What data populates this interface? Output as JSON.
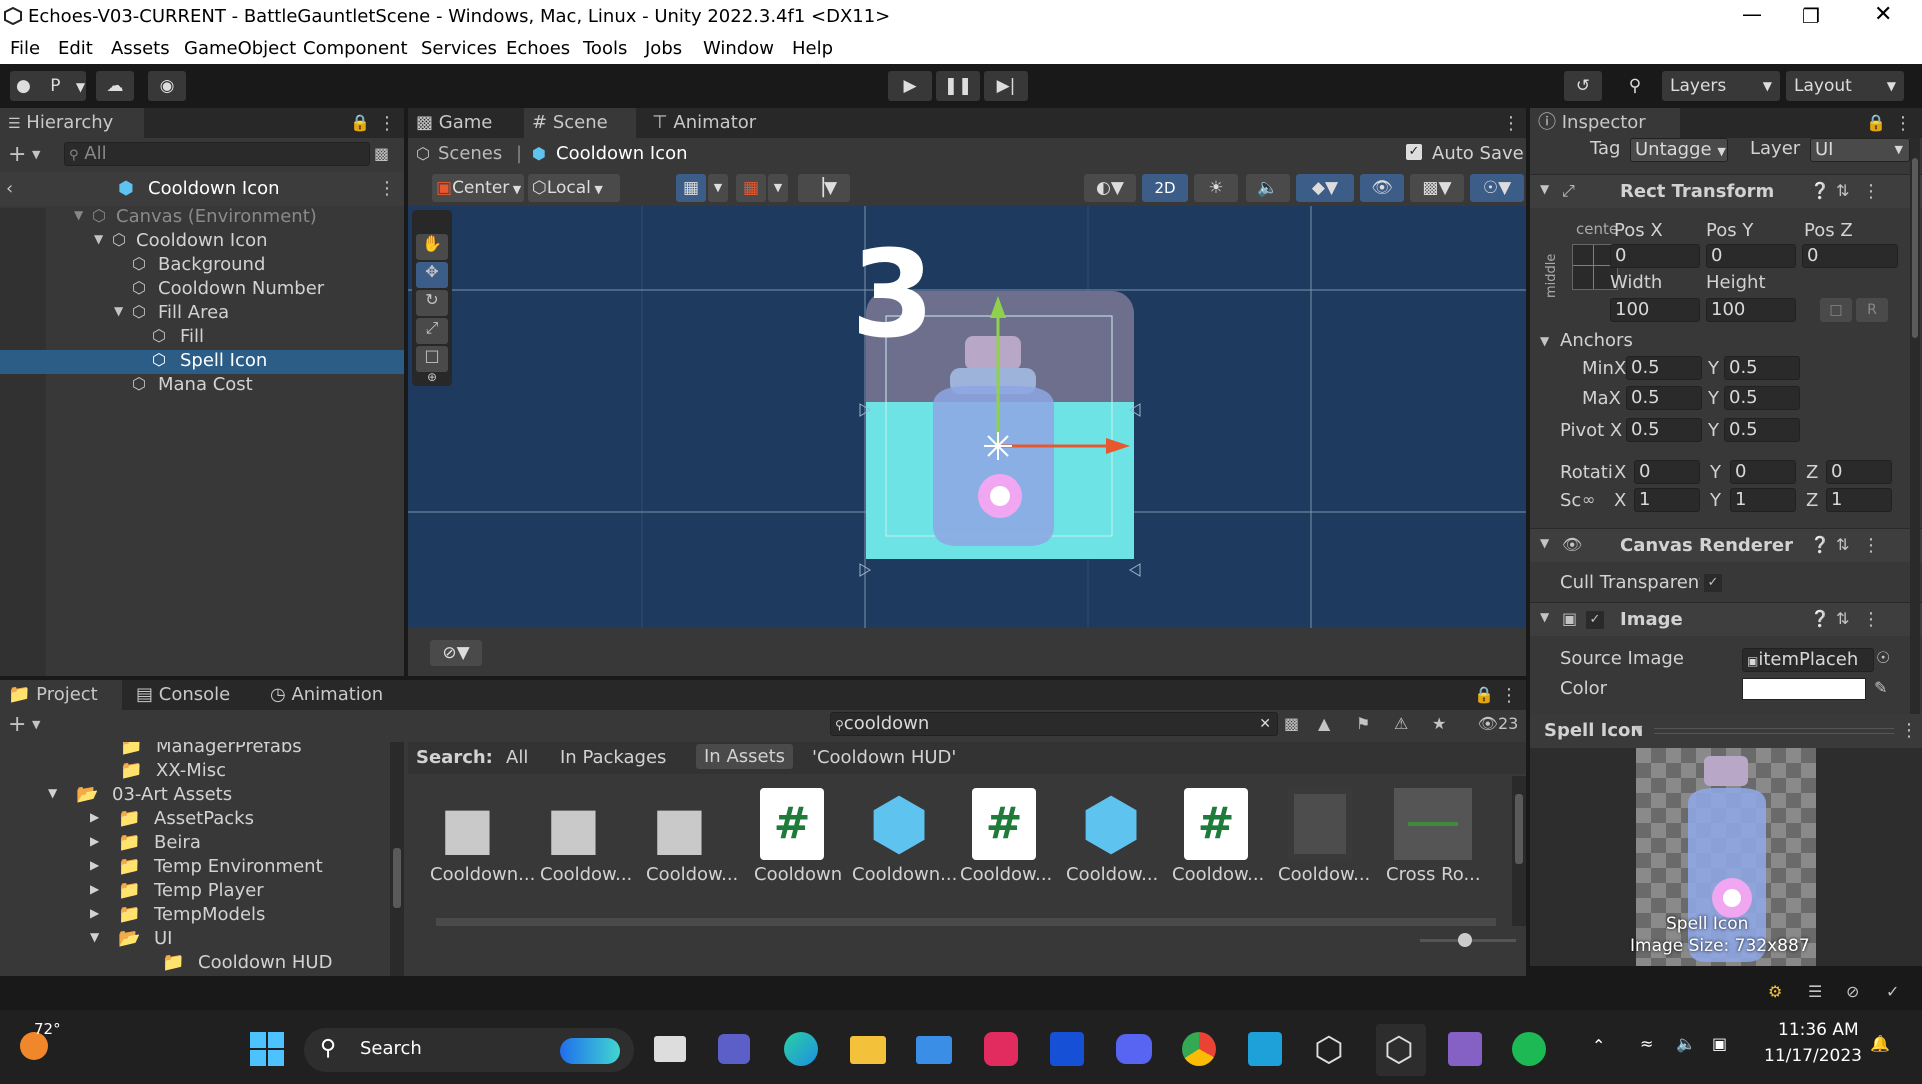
{
  "window": {
    "title": "Echoes-V03-CURRENT - BattleGauntletScene - Windows, Mac, Linux - Unity 2022.3.4f1 <DX11>"
  },
  "menu": [
    "File",
    "Edit",
    "Assets",
    "GameObject",
    "Component",
    "Services",
    "Echoes",
    "Tools",
    "Jobs",
    "Window",
    "Help"
  ],
  "toolbar": {
    "account_label": "P",
    "layers_label": "Layers",
    "layout_label": "Layout"
  },
  "hierarchy": {
    "tab": "Hierarchy",
    "search_placeholder": "All",
    "context_title": "Cooldown Icon",
    "items": [
      {
        "label": "Canvas (Environment)"
      },
      {
        "label": "Cooldown Icon"
      },
      {
        "label": "Background"
      },
      {
        "label": "Cooldown Number"
      },
      {
        "label": "Fill Area"
      },
      {
        "label": "Fill"
      },
      {
        "label": "Spell Icon"
      },
      {
        "label": "Mana Cost"
      }
    ]
  },
  "view_tabs": [
    "Game",
    "Scene",
    "Animator"
  ],
  "scene": {
    "breadcrumb_root": "Scenes",
    "breadcrumb_current": "Cooldown Icon",
    "auto_save": "Auto Save",
    "pivot": "Center",
    "space": "Local",
    "mode_2d": "2D",
    "cooldown_number": "3"
  },
  "inspector": {
    "tab": "Inspector",
    "tag_label": "Tag",
    "tag_value": "Untagge",
    "layer_label": "Layer",
    "layer_value": "UI",
    "rect_transform": {
      "title": "Rect Transform",
      "center_label": "cente",
      "middle_label": "middle",
      "pos_x_label": "Pos X",
      "pos_y_label": "Pos Y",
      "pos_z_label": "Pos Z",
      "pos_x": "0",
      "pos_y": "0",
      "pos_z": "0",
      "width_label": "Width",
      "height_label": "Height",
      "width": "100",
      "height": "100",
      "r_label": "R",
      "anchors_label": "Anchors",
      "min_label": "MinX",
      "min_x": "0.5",
      "min_y": "0.5",
      "max_label": "MaX",
      "max_x": "0.5",
      "max_y": "0.5",
      "pivot_label": "Pivot X",
      "pivot_x": "0.5",
      "pivot_y": "0.5",
      "rotation_label": "Rotati",
      "rot_x": "0",
      "rot_y": "0",
      "rot_z": "0",
      "scale_label": "Sc",
      "scale_x": "1",
      "scale_y": "1",
      "scale_z": "1",
      "x_label": "X",
      "y_label": "Y",
      "z_label": "Z"
    },
    "canvas_renderer": {
      "title": "Canvas Renderer",
      "cull_label": "Cull Transparent Me"
    },
    "image": {
      "title": "Image",
      "source_label": "Source Image",
      "source_value": "itemPlaceh",
      "color_label": "Color",
      "color_value": "#ffffff"
    },
    "preview": {
      "dropdown": "Spell Icon",
      "name": "Spell Icon",
      "size": "Image Size: 732x887"
    }
  },
  "project": {
    "tabs": [
      "Project",
      "Console",
      "Animation"
    ],
    "search_value": "cooldown",
    "hidden_count": "23",
    "search_label": "Search:",
    "filters": [
      "All",
      "In Packages",
      "In Assets",
      "'Cooldown HUD'"
    ],
    "tree": [
      {
        "label": "ManagerPrefabs"
      },
      {
        "label": "XX-Misc"
      },
      {
        "label": "03-Art Assets"
      },
      {
        "label": "AssetPacks"
      },
      {
        "label": "Beira"
      },
      {
        "label": "Temp Environment"
      },
      {
        "label": "Temp Player"
      },
      {
        "label": "TempModels"
      },
      {
        "label": "UI"
      },
      {
        "label": "Cooldown HUD"
      }
    ],
    "assets": [
      {
        "label": "Cooldown...",
        "kind": "folder-icon"
      },
      {
        "label": "Cooldow...",
        "kind": "folder-icon"
      },
      {
        "label": "Cooldow...",
        "kind": "folder-icon"
      },
      {
        "label": "Cooldown",
        "kind": "script-icon"
      },
      {
        "label": "Cooldown...",
        "kind": "prefab-icon"
      },
      {
        "label": "Cooldow...",
        "kind": "script-icon"
      },
      {
        "label": "Cooldow...",
        "kind": "prefab-icon"
      },
      {
        "label": "Cooldow...",
        "kind": "script-icon"
      },
      {
        "label": "Cooldow...",
        "kind": "sprite-icon"
      },
      {
        "label": "Cross Ro...",
        "kind": "model-icon"
      }
    ]
  },
  "taskbar": {
    "temp": "72°",
    "search": "Search",
    "time": "11:36 AM",
    "date": "11/17/2023"
  },
  "colors": {
    "accent": "#2c5d87",
    "scene_bg": "#1e3a5f",
    "fill_cyan": "#6ee3e6",
    "gizmo_green": "#8fd14f",
    "gizmo_red": "#e8582f"
  }
}
